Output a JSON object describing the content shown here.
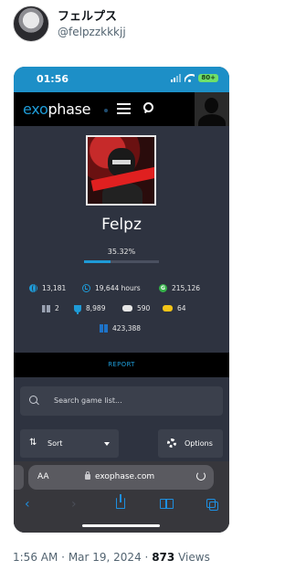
{
  "tweet": {
    "display_name": "フェルプス",
    "handle": "@felpzzkkkjj",
    "time": "1:56 AM",
    "separator": "·",
    "date": "Mar 19, 2024",
    "views_count": "873",
    "views_label": "Views"
  },
  "status_bar": {
    "time": "01:56",
    "battery": "80+"
  },
  "site_nav": {
    "logo_prefix": "exo",
    "logo_suffix": "phase"
  },
  "profile": {
    "username": "Felpz",
    "completion": "35.32%",
    "completion_fraction": 0.3532,
    "stats": {
      "games": "13,181",
      "hours": "19,644 hours",
      "gamerscore": "215,126",
      "rank": "2",
      "trophies": "8,989",
      "playstation": "590",
      "xbox": "64",
      "windows": "423,388"
    },
    "report_label": "REPORT"
  },
  "game_list": {
    "search_placeholder": "Search game list...",
    "sort_label": "Sort",
    "options_label": "Options"
  },
  "safari": {
    "aa_label": "AA",
    "url": "exophase.com"
  },
  "colors": {
    "accent": "#1e9bd7",
    "panel": "#2e3340",
    "safari_blue": "#1e8fe0"
  }
}
